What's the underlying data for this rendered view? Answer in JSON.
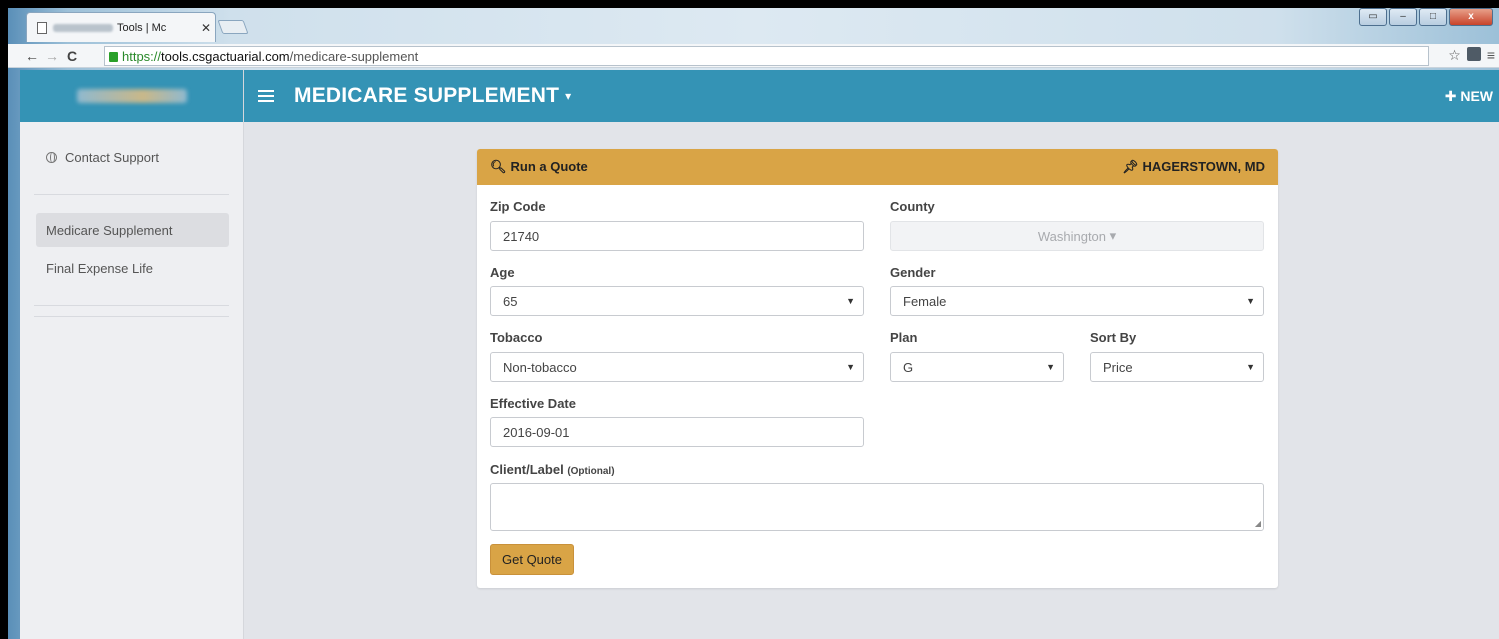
{
  "browser": {
    "tab_title": "Tools | Mc",
    "tab_close": "✕",
    "url_https": "https://",
    "url_host": "tools.csgactuarial.com",
    "url_path": "/medicare-supplement"
  },
  "sidebar": {
    "contact": "Contact Support",
    "items": [
      {
        "label": "Medicare Supplement",
        "active": true
      },
      {
        "label": "Final Expense Life",
        "active": false
      }
    ]
  },
  "header": {
    "title": "MEDICARE SUPPLEMENT",
    "new_label": "NEW"
  },
  "card": {
    "title": "Run a Quote",
    "location": "HAGERSTOWN, MD",
    "zip": {
      "label": "Zip Code",
      "value": "21740"
    },
    "county": {
      "label": "County",
      "value": "Washington"
    },
    "age": {
      "label": "Age",
      "value": "65"
    },
    "gender": {
      "label": "Gender",
      "value": "Female"
    },
    "tobacco": {
      "label": "Tobacco",
      "value": "Non-tobacco"
    },
    "plan": {
      "label": "Plan",
      "value": "G"
    },
    "sort": {
      "label": "Sort By",
      "value": "Price"
    },
    "date": {
      "label": "Effective Date",
      "value": "2016-09-01"
    },
    "client": {
      "label": "Client/Label",
      "optional": "(Optional)",
      "value": ""
    },
    "button": "Get Quote"
  }
}
